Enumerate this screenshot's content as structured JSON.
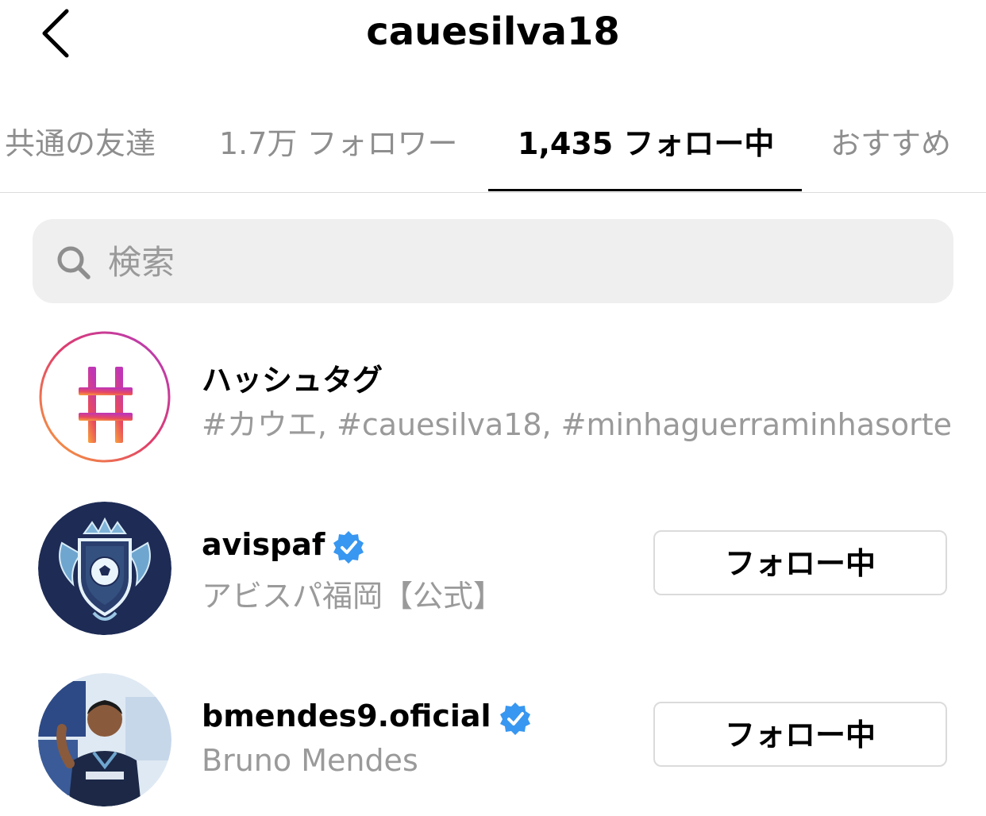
{
  "header": {
    "title": "cauesilva18"
  },
  "tabs": [
    {
      "label": "共通の友達"
    },
    {
      "label": "1.7万 フォロワー"
    },
    {
      "label": "1,435 フォロー中"
    },
    {
      "label": "おすすめ"
    }
  ],
  "active_tab": "1,435 フォロー中",
  "search": {
    "placeholder": "検索"
  },
  "list": [
    {
      "name": "ハッシュタグ",
      "subtitle": "#カウエ, #cauesilva18, #minhaguerraminhasorte",
      "avatar_icon": "hashtag-icon"
    },
    {
      "name": "avispaf",
      "subtitle": "アビスパ福岡【公式】",
      "verified": true,
      "button": "フォロー中",
      "avatar_icon": "avispa-crest-avatar"
    },
    {
      "name": "bmendes9.oficial",
      "subtitle": "Bruno Mendes",
      "verified": true,
      "button": "フォロー中",
      "avatar_icon": "player-photo-avatar"
    }
  ],
  "colors": {
    "verified_blue": "#3897f0",
    "muted_text": "#9a9a9a",
    "tab_inactive": "#8e8e8e",
    "search_bg": "#efefef",
    "crest_bg": "#1d2b55"
  }
}
